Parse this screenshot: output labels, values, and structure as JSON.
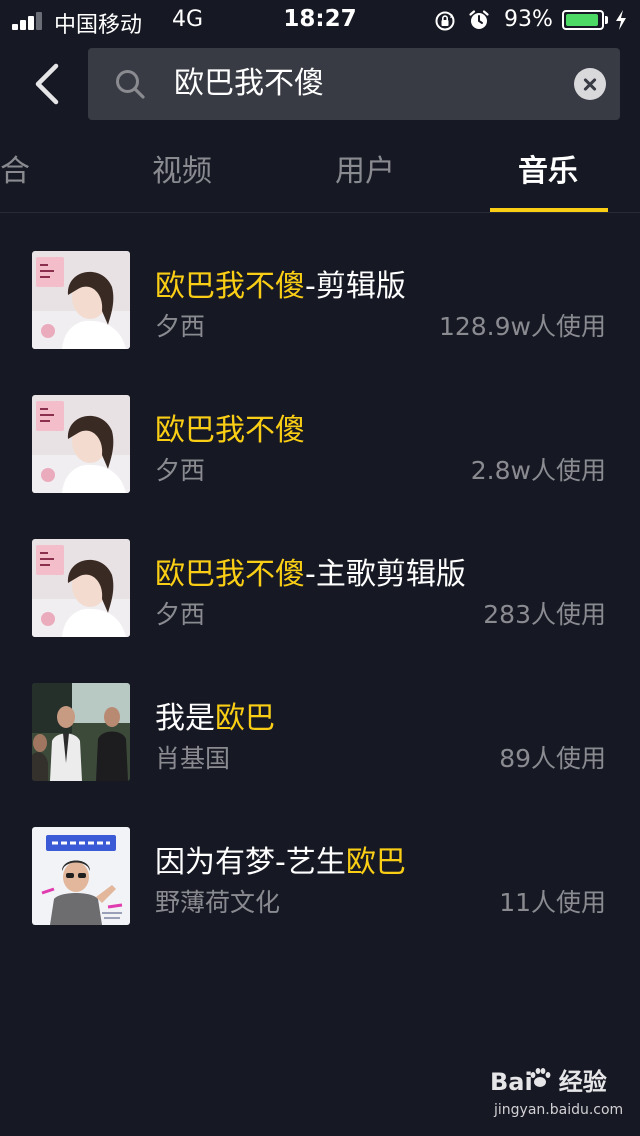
{
  "status_bar": {
    "carrier": "中国移动",
    "network": "4G",
    "time": "18:27",
    "battery_percent": "93%",
    "battery_level": 0.93,
    "signal_bars": 3,
    "icons": [
      "orientation-lock-icon",
      "alarm-icon",
      "charging-icon"
    ]
  },
  "search": {
    "query": "欧巴我不傻",
    "icons": [
      "back-arrow-icon",
      "search-icon",
      "clear-icon"
    ]
  },
  "tabs": [
    {
      "label": "合",
      "active": false
    },
    {
      "label": "视频",
      "active": false
    },
    {
      "label": "用户",
      "active": false
    },
    {
      "label": "音乐",
      "active": true
    }
  ],
  "colors": {
    "background": "#161823",
    "highlight": "#face15",
    "search_box": "#393b44",
    "secondary_text": "#8a8b91"
  },
  "results": [
    {
      "title_pre": "",
      "title_hl": "欧巴我不傻",
      "title_post": "-剪辑版",
      "artist": "夕西",
      "usage": "128.9w人使用"
    },
    {
      "title_pre": "",
      "title_hl": "欧巴我不傻",
      "title_post": "",
      "artist": "夕西",
      "usage": "2.8w人使用"
    },
    {
      "title_pre": "",
      "title_hl": "欧巴我不傻",
      "title_post": "-主歌剪辑版",
      "artist": "夕西",
      "usage": "283人使用"
    },
    {
      "title_pre": "我是",
      "title_hl": "欧巴",
      "title_post": "",
      "artist": "肖基国",
      "usage": "89人使用"
    },
    {
      "title_pre": "因为有梦-艺生",
      "title_hl": "欧巴",
      "title_post": "",
      "artist": "野薄荷文化",
      "usage": "11人使用"
    }
  ],
  "watermark": {
    "logo_left": "Bai",
    "logo_right": "经验",
    "url": "jingyan.baidu.com"
  }
}
